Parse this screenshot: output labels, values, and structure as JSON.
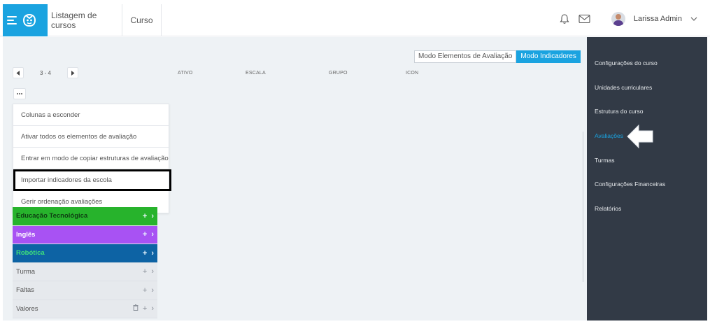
{
  "header": {
    "breadcrumbs": [
      "Listagem de cursos",
      "Curso"
    ],
    "user_name": "Larissa Admin"
  },
  "colors": {
    "brand": "#1aa3e0",
    "sidebar_bg": "#323a46",
    "green": "#27b32c",
    "purple": "#a852f3",
    "blue": "#0d63a4"
  },
  "modes": [
    "Modo Elementos de Avaliação",
    "Modo Indicadores"
  ],
  "active_mode": "Modo Indicadores",
  "pager": {
    "range": "3 - 4"
  },
  "columns": [
    "ATIVO",
    "ESCALA",
    "GRUPO",
    "ICON"
  ],
  "menu": [
    "Colunas a esconder",
    "Ativar todos os elementos de avaliação",
    "Entrar em modo de copiar estruturas de avaliação",
    "Importar indicadores da escola",
    "Gerir ordenação avaliações"
  ],
  "rows": [
    {
      "label": "Educação Tecnológica",
      "style": "green"
    },
    {
      "label": "Inglês",
      "style": "purple"
    },
    {
      "label": "Robótica",
      "style": "blue"
    },
    {
      "label": "Turma",
      "style": "grey"
    },
    {
      "label": "Faltas",
      "style": "grey"
    },
    {
      "label": "Valores",
      "style": "grey"
    }
  ],
  "sidebar": {
    "items": [
      "Configurações do curso",
      "Unidades curriculares",
      "Estrutura do curso",
      "Avaliações",
      "Turmas",
      "Configurações Financeiras",
      "Relatórios"
    ],
    "active": "Avaliações"
  },
  "icons": [
    "menu-icon",
    "logo-icon",
    "bell-icon",
    "mail-icon",
    "avatar",
    "chevron-down-icon",
    "chevron-left-icon",
    "chevron-right-icon",
    "more-icon",
    "plus-icon",
    "trash-icon",
    "pointer-arrow-icon"
  ]
}
